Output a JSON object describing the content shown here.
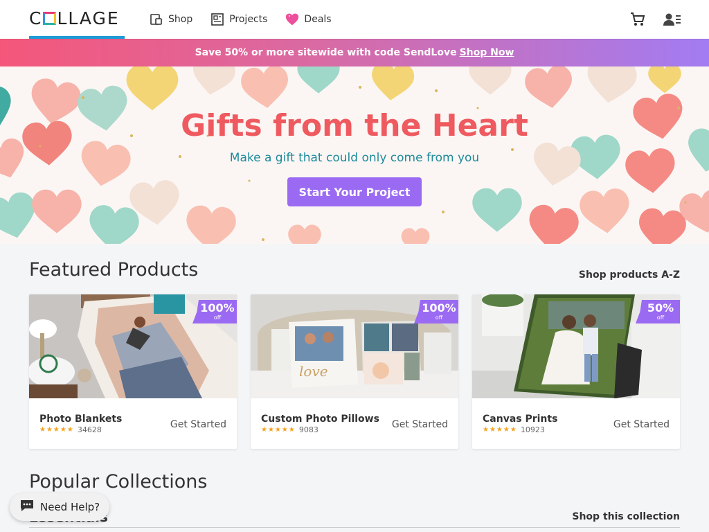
{
  "header": {
    "logo_text": "COLLAGE",
    "nav": [
      {
        "label": "Shop",
        "icon": "shop-icon"
      },
      {
        "label": "Projects",
        "icon": "projects-icon"
      },
      {
        "label": "Deals",
        "icon": "heart-icon"
      }
    ],
    "right_icons": [
      "cart-icon",
      "account-icon"
    ]
  },
  "promo": {
    "text": "Save 50% or more sitewide with code SendLove",
    "link": "Shop Now"
  },
  "hero": {
    "title": "Gifts from the Heart",
    "subtitle": "Make a gift that could only come from you",
    "button": "Start Your Project",
    "colors": {
      "title": "#ee5a5f",
      "subtitle": "#1f8a9a",
      "button": "#9b6af3"
    }
  },
  "featured": {
    "title": "Featured Products",
    "link": "Shop products A-Z",
    "products": [
      {
        "name": "Photo Blankets",
        "discount": "100%",
        "discount_label": "off",
        "stars": "★★★★★",
        "reviews": "34628",
        "cta": "Get Started"
      },
      {
        "name": "Custom Photo Pillows",
        "discount": "100%",
        "discount_label": "off",
        "stars": "★★★★★",
        "reviews": "9083",
        "cta": "Get Started"
      },
      {
        "name": "Canvas Prints",
        "discount": "50%",
        "discount_label": "off",
        "stars": "★★★★★",
        "reviews": "10923",
        "cta": "Get Started"
      }
    ]
  },
  "popular": {
    "title": "Popular Collections",
    "collection_name": "Essentials",
    "collection_link": "Shop this collection"
  },
  "help": {
    "label": "Need Help?",
    "icon": "chat-icon"
  }
}
